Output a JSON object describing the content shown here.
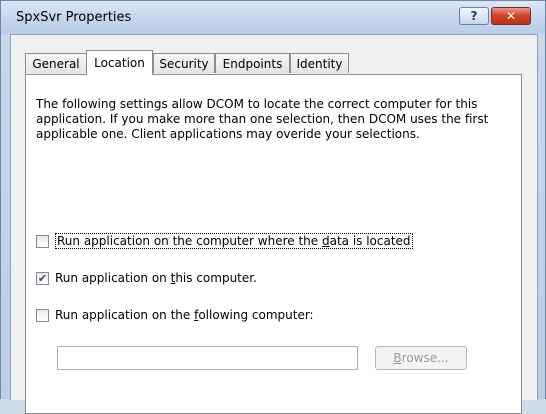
{
  "window": {
    "title": "SpxSvr Properties",
    "help_glyph": "?",
    "close_glyph": "✕"
  },
  "tabs": [
    {
      "label": "General"
    },
    {
      "label": "Location"
    },
    {
      "label": "Security"
    },
    {
      "label": "Endpoints"
    },
    {
      "label": "Identity"
    }
  ],
  "active_tab": "Location",
  "location": {
    "description": "The following settings allow DCOM to locate the correct computer for this application. If you make more than one selection, then DCOM uses the first applicable one. Client applications may overide your selections.",
    "options": [
      {
        "label_before": "Run application on the computer where the ",
        "mnemonic": "d",
        "label_after": "ata is located",
        "checked": false,
        "check_glyph": ""
      },
      {
        "label_before": "Run application on ",
        "mnemonic": "t",
        "label_after": "his computer.",
        "checked": true,
        "check_glyph": "✔"
      },
      {
        "label_before": "Run application on the ",
        "mnemonic": "f",
        "label_after": "ollowing computer:",
        "checked": false,
        "check_glyph": ""
      }
    ],
    "computer_name_value": "",
    "browse": {
      "mnemonic": "B",
      "label_rest": "rowse...",
      "enabled": false
    }
  }
}
